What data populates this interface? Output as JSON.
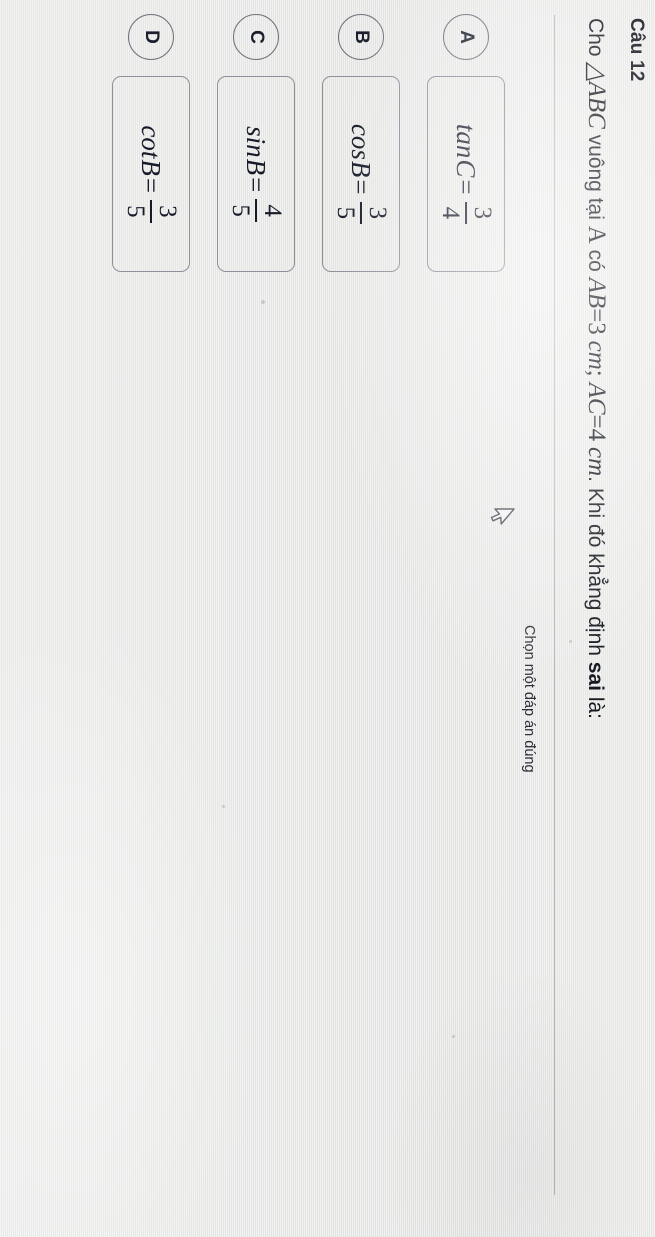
{
  "question": {
    "number_label": "Câu 12",
    "prefix": "Cho ",
    "triangle_symbol": "△",
    "triangle_name": "ABC",
    "mid_text": " vuông tại ",
    "vertex": "A",
    "has_text": " có ",
    "side1": "AB",
    "eq1": "=",
    "side1_value": "3",
    "unit1": "cm",
    "separator": ";",
    "side2": "AC",
    "eq2": "=",
    "side2_value": "4",
    "unit2": "cm",
    "tail_text": ". Khi đó khẳng định ",
    "emphasis": "sai",
    "tail_end": " là:",
    "full_text": "Cho △ABC vuông tại A có AB=3 cm; AC=4 cm. Khi đó khẳng định sai là:"
  },
  "instruction": {
    "text": "Chọn một đáp án đúng"
  },
  "options": [
    {
      "letter": "A",
      "function": "tan",
      "variable": "C",
      "equals": "=",
      "numerator": "3",
      "denominator": "4",
      "expression": "tanC = 3/4"
    },
    {
      "letter": "B",
      "function": "cos",
      "variable": "B",
      "equals": "=",
      "numerator": "3",
      "denominator": "5",
      "expression": "cosB = 3/5"
    },
    {
      "letter": "C",
      "function": "sin",
      "variable": "B",
      "equals": "=",
      "numerator": "4",
      "denominator": "5",
      "expression": "sinB = 4/5"
    },
    {
      "letter": "D",
      "function": "cot",
      "variable": "B",
      "equals": "=",
      "numerator": "3",
      "denominator": "5",
      "expression": "cotB = 3/5"
    }
  ],
  "cursor": {
    "icon": "mouse-pointer-icon"
  },
  "colors": {
    "background": "#e9eae8",
    "text": "#171b29",
    "border": "#8d9098",
    "divider": "#b9bbba"
  }
}
